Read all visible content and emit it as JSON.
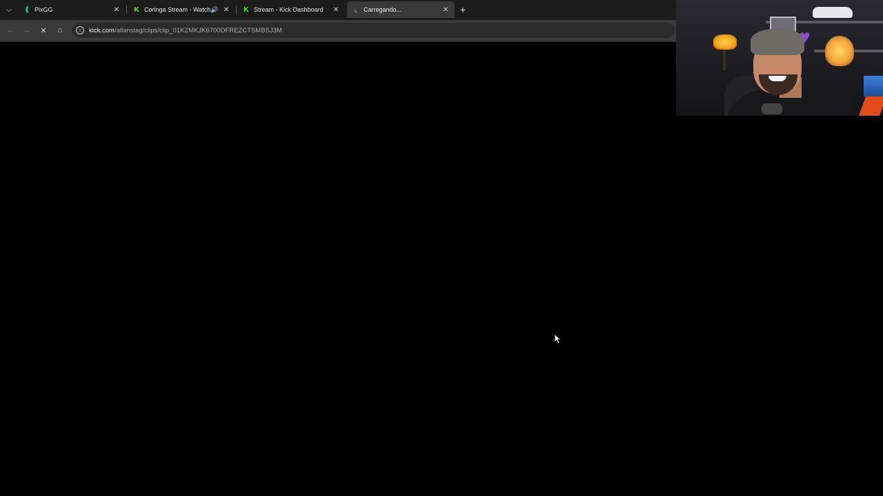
{
  "browser": {
    "tabs": [
      {
        "title": "PixGG",
        "favicon_color": "#2fd4a6",
        "active": false,
        "audio": false
      },
      {
        "title": "Coringa Stream - Watch Liv",
        "favicon_color": "#53fc18",
        "active": false,
        "audio": true
      },
      {
        "title": "Stream - Kick Dashboard",
        "favicon_color": "#53fc18",
        "active": false,
        "audio": false
      },
      {
        "title": "Carregando...",
        "favicon_color": "#bdbdbd",
        "active": true,
        "audio": false
      }
    ],
    "url_host": "kick.com",
    "url_path": "/allanstag/clips/clip_01KZMKJK6700DFREZCTSMBSJ3M",
    "page_state": "loading"
  },
  "webcam": {
    "subject": "streamer"
  },
  "colors": {
    "tabstrip_bg": "#1c1c1c",
    "toolbar_bg": "#3a3a3a",
    "page_bg": "#000000",
    "kick_green": "#53fc18"
  },
  "icons": {
    "tab_menu": "chevron-down-icon",
    "close": "close-icon",
    "new_tab": "plus-icon",
    "back": "arrow-left-icon",
    "forward": "arrow-right-icon",
    "stop": "stop-loading-icon",
    "home": "home-icon",
    "site_info": "info-icon",
    "audio": "speaker-icon"
  }
}
